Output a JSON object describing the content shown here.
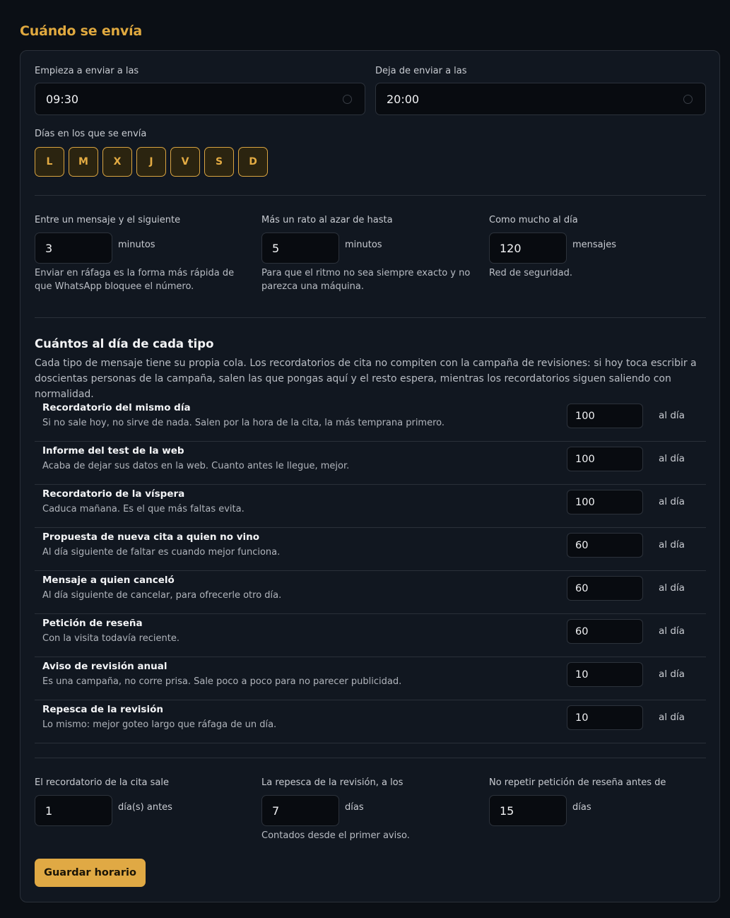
{
  "title": "Cuándo se envía",
  "start": {
    "label": "Empieza a enviar a las",
    "value": "09:30"
  },
  "stop": {
    "label": "Deja de enviar a las",
    "value": "20:00"
  },
  "days": {
    "label": "Días en los que se envía",
    "items": [
      "L",
      "M",
      "X",
      "J",
      "V",
      "S",
      "D"
    ]
  },
  "interval": {
    "label": "Entre un mensaje y el siguiente",
    "value": "3",
    "unit": "minutos",
    "help": "Enviar en ráfaga es la forma más rápida de que WhatsApp bloquee el número."
  },
  "random": {
    "label": "Más un rato al azar de hasta",
    "value": "5",
    "unit": "minutos",
    "help": "Para que el ritmo no sea siempre exacto y no parezca una máquina."
  },
  "max": {
    "label": "Como mucho al día",
    "value": "120",
    "unit": "mensajes",
    "help": "Red de seguridad."
  },
  "types": {
    "title": "Cuántos al día de cada tipo",
    "desc": "Cada tipo de mensaje tiene su propia cola. Los recordatorios de cita no compiten con la campaña de revisiones: si hoy toca escribir a doscientas personas de la campaña, salen las que pongas aquí y el resto espera, mientras los recordatorios siguen saliendo con normalidad.",
    "unit": "al día",
    "rows": [
      {
        "name": "Recordatorio del mismo día",
        "desc": "Si no sale hoy, no sirve de nada. Salen por la hora de la cita, la más temprana primero.",
        "value": "100"
      },
      {
        "name": "Informe del test de la web",
        "desc": "Acaba de dejar sus datos en la web. Cuanto antes le llegue, mejor.",
        "value": "100"
      },
      {
        "name": "Recordatorio de la víspera",
        "desc": "Caduca mañana. Es el que más faltas evita.",
        "value": "100"
      },
      {
        "name": "Propuesta de nueva cita a quien no vino",
        "desc": "Al día siguiente de faltar es cuando mejor funciona.",
        "value": "60"
      },
      {
        "name": "Mensaje a quien canceló",
        "desc": "Al día siguiente de cancelar, para ofrecerle otro día.",
        "value": "60"
      },
      {
        "name": "Petición de reseña",
        "desc": "Con la visita todavía reciente.",
        "value": "60"
      },
      {
        "name": "Aviso de revisión anual",
        "desc": "Es una campaña, no corre prisa. Sale poco a poco para no parecer publicidad.",
        "value": "10"
      },
      {
        "name": "Repesca de la revisión",
        "desc": "Lo mismo: mejor goteo largo que ráfaga de un día.",
        "value": "10"
      }
    ]
  },
  "reminder": {
    "label": "El recordatorio de la cita sale",
    "value": "1",
    "unit": "día(s) antes"
  },
  "repesca": {
    "label": "La repesca de la revisión, a los",
    "value": "7",
    "unit": "días",
    "help": "Contados desde el primer aviso."
  },
  "review": {
    "label": "No repetir petición de reseña antes de",
    "value": "15",
    "unit": "días"
  },
  "save_label": "Guardar horario"
}
